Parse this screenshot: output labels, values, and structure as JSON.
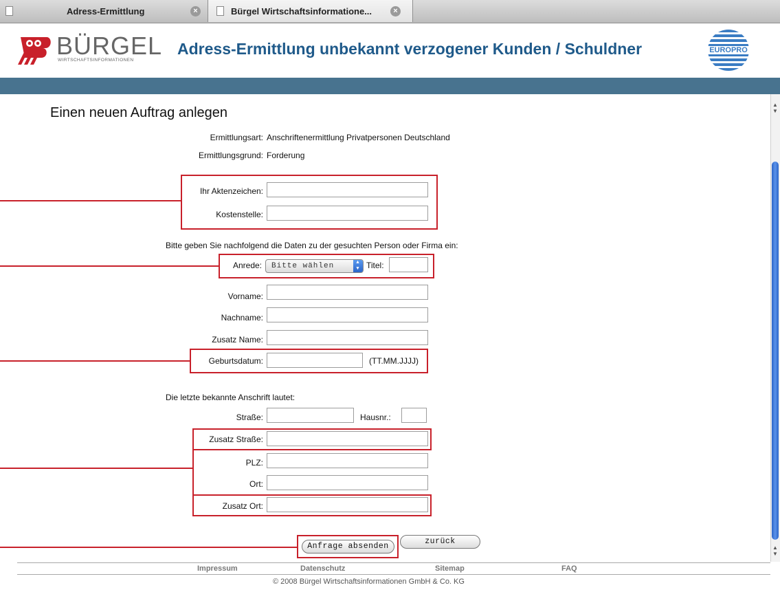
{
  "browser": {
    "tabs": [
      {
        "title": "Adress-Ermittlung"
      },
      {
        "title": "Bürgel Wirtschaftsinformatione..."
      }
    ]
  },
  "header": {
    "logo_text": "BÜRGEL",
    "logo_subtext": "WIRTSCHAFTSINFORMATIONEN",
    "title": "Adress-Ermittlung unbekannt verzogener Kunden / Schuldner",
    "partner_logo_text": "EUROPRO"
  },
  "colors": {
    "brand_red": "#c8202a",
    "brand_blue": "#1f5a8a",
    "stripe": "#48738f"
  },
  "form": {
    "heading": "Einen neuen Auftrag anlegen",
    "ermittlungsart_label": "Ermittlungsart:",
    "ermittlungsart_value": "Anschriftenermittlung Privatpersonen Deutschland",
    "ermittlungsgrund_label": "Ermittlungsgrund:",
    "ermittlungsgrund_value": "Forderung",
    "aktenzeichen_label": "Ihr Aktenzeichen:",
    "aktenzeichen_value": "",
    "kostenstelle_label": "Kostenstelle:",
    "kostenstelle_value": "",
    "person_intro": "Bitte geben Sie nachfolgend die Daten zu der gesuchten Person oder Firma ein:",
    "anrede_label": "Anrede:",
    "anrede_selected": "Bitte wählen",
    "titel_label": "Titel:",
    "titel_value": "",
    "vorname_label": "Vorname:",
    "vorname_value": "",
    "nachname_label": "Nachname:",
    "nachname_value": "",
    "zusatz_name_label": "Zusatz Name:",
    "zusatz_name_value": "",
    "geburtsdatum_label": "Geburtsdatum:",
    "geburtsdatum_value": "",
    "geburtsdatum_hint": "(TT.MM.JJJJ)",
    "address_intro": "Die letzte bekannte Anschrift lautet:",
    "strasse_label": "Straße:",
    "strasse_value": "",
    "hausnr_label": "Hausnr.:",
    "hausnr_value": "",
    "zusatz_strasse_label": "Zusatz Straße:",
    "zusatz_strasse_value": "",
    "plz_label": "PLZ:",
    "plz_value": "",
    "ort_label": "Ort:",
    "ort_value": "",
    "zusatz_ort_label": "Zusatz Ort:",
    "zusatz_ort_value": "",
    "submit_label": "Anfrage absenden",
    "back_label": "zurück"
  },
  "footer": {
    "links": [
      "Impressum",
      "Datenschutz",
      "Sitemap",
      "FAQ"
    ],
    "copyright": "© 2008 Bürgel Wirtschaftsinformationen GmbH & Co. KG"
  }
}
